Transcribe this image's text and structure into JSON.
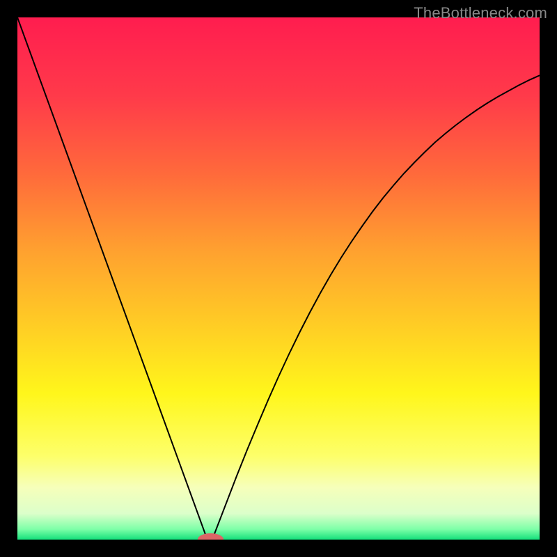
{
  "watermark_text": "TheBottleneck.com",
  "chart_data": {
    "type": "line",
    "title": "",
    "xlabel": "",
    "ylabel": "",
    "xlim": [
      0,
      100
    ],
    "ylim": [
      0,
      100
    ],
    "x": [
      0,
      2,
      4,
      6,
      8,
      10,
      12,
      14,
      16,
      18,
      20,
      22,
      24,
      26,
      28,
      30,
      32,
      34,
      35,
      36,
      36.5,
      37,
      37.5,
      38,
      40,
      42,
      44,
      46,
      48,
      50,
      52,
      54,
      56,
      58,
      60,
      62,
      64,
      66,
      68,
      70,
      72,
      74,
      76,
      78,
      80,
      82,
      84,
      86,
      88,
      90,
      92,
      94,
      96,
      98,
      100
    ],
    "y": [
      100,
      94.5,
      89.0,
      83.5,
      78.0,
      72.5,
      67.0,
      61.5,
      56.0,
      50.5,
      45.0,
      39.5,
      34.0,
      28.5,
      23.0,
      17.5,
      12.0,
      6.5,
      3.75,
      1.0,
      0.5,
      0,
      0.5,
      1.8,
      7.0,
      12.2,
      17.2,
      22.0,
      26.7,
      31.2,
      35.5,
      39.6,
      43.5,
      47.2,
      50.7,
      54.0,
      57.1,
      60.0,
      62.8,
      65.4,
      67.8,
      70.1,
      72.2,
      74.2,
      76.1,
      77.8,
      79.4,
      80.9,
      82.3,
      83.6,
      84.8,
      85.9,
      87.0,
      88.0,
      88.9
    ],
    "marker": {
      "cx": 37.0,
      "cy": 0.0,
      "rx": 2.5,
      "ry": 1.2
    },
    "gradient_stops": [
      {
        "offset": 0,
        "color": "#ff1d4f"
      },
      {
        "offset": 15,
        "color": "#ff3a4a"
      },
      {
        "offset": 30,
        "color": "#ff6a3b"
      },
      {
        "offset": 45,
        "color": "#ffa22f"
      },
      {
        "offset": 60,
        "color": "#ffd024"
      },
      {
        "offset": 72,
        "color": "#fff61b"
      },
      {
        "offset": 84,
        "color": "#fdff6a"
      },
      {
        "offset": 90,
        "color": "#f6ffba"
      },
      {
        "offset": 95,
        "color": "#dcffca"
      },
      {
        "offset": 98,
        "color": "#7effa8"
      },
      {
        "offset": 100,
        "color": "#14e07c"
      }
    ]
  }
}
